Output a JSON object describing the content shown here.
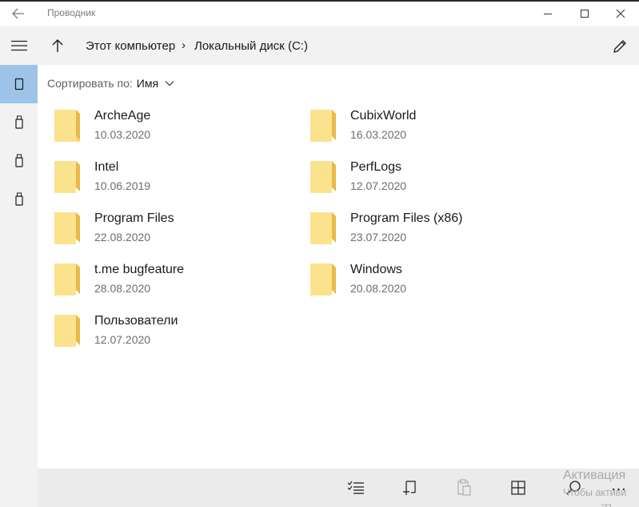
{
  "window": {
    "title": "Проводник"
  },
  "breadcrumb": {
    "items": [
      "Этот компьютер",
      "Локальный диск (C:)"
    ],
    "separator": "›"
  },
  "sort": {
    "label": "Сортировать по:",
    "value": "Имя"
  },
  "items": [
    {
      "name": "ArcheAge",
      "date": "10.03.2020"
    },
    {
      "name": "CubixWorld",
      "date": "16.03.2020"
    },
    {
      "name": "Intel",
      "date": "10.06.2019"
    },
    {
      "name": "PerfLogs",
      "date": "12.07.2020"
    },
    {
      "name": "Program Files",
      "date": "22.08.2020"
    },
    {
      "name": "Program Files (x86)",
      "date": "23.07.2020"
    },
    {
      "name": "t.me bugfeature",
      "date": "28.08.2020"
    },
    {
      "name": "Windows",
      "date": "20.08.2020"
    },
    {
      "name": "Пользователи",
      "date": "12.07.2020"
    }
  ],
  "rail": {
    "items": [
      {
        "icon": "drive-icon",
        "selected": true
      },
      {
        "icon": "usb-drive-icon",
        "selected": false
      },
      {
        "icon": "usb-drive-icon",
        "selected": false
      },
      {
        "icon": "usb-drive-icon",
        "selected": false
      }
    ]
  },
  "commandbar": {
    "icons": [
      "select-list-icon",
      "new-item-icon",
      "paste-icon",
      "grid-view-icon",
      "search-icon",
      "more-icon"
    ],
    "more_label": "…"
  },
  "watermark": {
    "line1": "Активация",
    "line2": "Чтобы активи",
    "line3": "\"П"
  },
  "colors": {
    "accent_selected": "#9dc3e8",
    "folder_fill": "#fcd766",
    "folder_light": "#fbe38e",
    "rail_bg": "#f2f2f2",
    "cmdbar_bg": "#ebebeb"
  }
}
